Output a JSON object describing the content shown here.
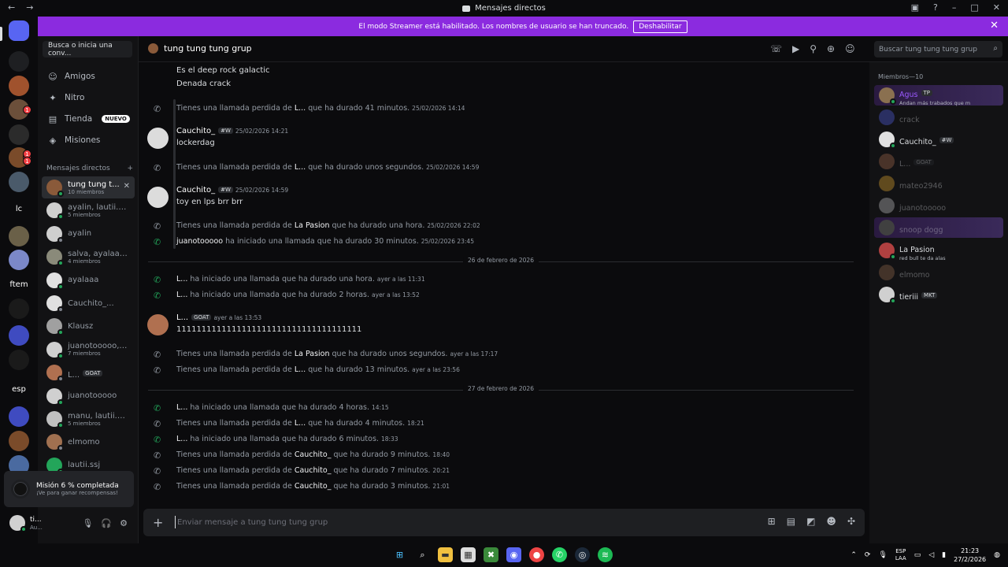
{
  "window": {
    "title": "Mensajes directos",
    "back": "←",
    "forward": "→"
  },
  "banner": {
    "text": "El modo Streamer está habilitado. Los nombres de usuario se han truncado.",
    "button": "Deshabilitar"
  },
  "guilds": [
    {
      "label": "",
      "color": "#5865f2",
      "icon": "discord-icon"
    },
    {
      "label": "",
      "color": "#1e1f22",
      "icon": "z-icon"
    },
    {
      "label": "",
      "color": "#a0522d"
    },
    {
      "label": "",
      "color": "#6b4f3a"
    },
    {
      "label": "",
      "color": "#2b2b2b"
    },
    {
      "label": "",
      "color": "#7a4b2a"
    },
    {
      "label": "",
      "color": "#4a5a6a"
    },
    {
      "label": "lc",
      "color": "transparent"
    },
    {
      "label": "",
      "color": "#6a6048"
    },
    {
      "label": "",
      "color": "#7b88c8"
    },
    {
      "label": "ftem",
      "color": "transparent"
    },
    {
      "label": "",
      "color": "#1a1a1a"
    },
    {
      "label": "",
      "color": "#3f4bc0"
    },
    {
      "label": "",
      "color": "#1a1a1a"
    },
    {
      "label": "esp",
      "color": "transparent"
    },
    {
      "label": "",
      "color": "#3f4bc0"
    },
    {
      "label": "",
      "color": "#7a4b2a"
    },
    {
      "label": "",
      "color": "#4a6aa0"
    }
  ],
  "guild_badges": [
    "1",
    "1",
    "1",
    "1"
  ],
  "sidebar": {
    "search": "Busca o inicia una conv...",
    "nav": [
      {
        "label": "Amigos",
        "icon": "friends-icon"
      },
      {
        "label": "Nitro",
        "icon": "nitro-icon"
      },
      {
        "label": "Tienda",
        "icon": "shop-icon",
        "tag": "NUEVO"
      },
      {
        "label": "Misiones",
        "icon": "quests-icon"
      }
    ],
    "dm_header": "Mensajes directos",
    "dm_add": "+",
    "dms": [
      {
        "name": "tung tung t...",
        "sub": "10 miembros",
        "color": "#8a5a3a",
        "active": true
      },
      {
        "name": "ayalin, lautii.ss...",
        "sub": "5 miembros",
        "color": "#cfcfcf"
      },
      {
        "name": "ayalin",
        "sub": "",
        "color": "#cfcfcf"
      },
      {
        "name": "salva, ayalaaa, ...",
        "sub": "4 miembros",
        "color": "#8a8a7a"
      },
      {
        "name": "ayalaaa",
        "sub": "",
        "color": "#e0e0e0"
      },
      {
        "name": "Cauchito_...",
        "sub": "",
        "color": "#e0e0e0"
      },
      {
        "name": "Klausz",
        "sub": "",
        "color": "#a0a0a0"
      },
      {
        "name": "juanotooooo, ...",
        "sub": "7 miembros",
        "color": "#d0d0d0"
      },
      {
        "name": "L...",
        "sub": "",
        "color": "#b07050",
        "tag": "GOAT"
      },
      {
        "name": "juanotooooo",
        "sub": "",
        "color": "#d0d0d0"
      },
      {
        "name": "manu, lautii.ss...",
        "sub": "5 miembros",
        "color": "#c0c0c0"
      },
      {
        "name": "elmomo",
        "sub": "",
        "color": "#a07050"
      },
      {
        "name": "lautii.ssj",
        "sub": "",
        "color": "#23a55a"
      }
    ],
    "mission": {
      "title": "Misión 6 % completada",
      "sub": "¡Ve para ganar recompensas!"
    },
    "user": {
      "name": "ti...",
      "status": "Au..."
    }
  },
  "chat": {
    "title": "tung tung tung grup",
    "search_placeholder": "Buscar tung tung tung grup",
    "composer_placeholder": "Enviar mensaje a tung tung tung grup",
    "lines": [
      "Es el deep rock galactic",
      "Denada crack"
    ],
    "calls": [
      {
        "pre": "Tienes una llamada perdida de ",
        "who": "L...",
        "post": " que ha durado 41 minutos.",
        "ts": "25/02/2026 14:14",
        "missed": true
      },
      {
        "pre": "Tienes una llamada perdida de ",
        "who": "L...",
        "post": " que ha durado unos segundos.",
        "ts": "25/02/2026 14:59",
        "missed": true
      },
      {
        "pre": "Tienes una llamada perdida de ",
        "who": "La Pasion",
        "post": " que ha durado una hora.",
        "ts": "25/02/2026 22:02",
        "missed": true
      },
      {
        "pre": "",
        "who": "juanotooooo",
        "post": " ha iniciado una llamada que ha durado 30 minutos.",
        "ts": "25/02/2026 23:45",
        "missed": false
      },
      {
        "pre": "",
        "who": "L...",
        "post": " ha iniciado una llamada que ha durado una hora.",
        "ts": "ayer a las 11:31",
        "missed": false
      },
      {
        "pre": "",
        "who": "L...",
        "post": " ha iniciado una llamada que ha durado 2 horas.",
        "ts": "ayer a las 13:52",
        "missed": false
      },
      {
        "pre": "Tienes una llamada perdida de ",
        "who": "La Pasion",
        "post": " que ha durado unos segundos.",
        "ts": "ayer a las 17:17",
        "missed": true
      },
      {
        "pre": "Tienes una llamada perdida de ",
        "who": "L...",
        "post": " que ha durado 13 minutos.",
        "ts": "ayer a las 23:56",
        "missed": true
      },
      {
        "pre": "",
        "who": "L...",
        "post": " ha iniciado una llamada que ha durado 4 horas.",
        "ts": "14:15",
        "missed": false
      },
      {
        "pre": "Tienes una llamada perdida de ",
        "who": "L...",
        "post": " que ha durado 4 minutos.",
        "ts": "18:21",
        "missed": true
      },
      {
        "pre": "",
        "who": "L...",
        "post": " ha iniciado una llamada que ha durado 6 minutos.",
        "ts": "18:33",
        "missed": false
      },
      {
        "pre": "Tienes una llamada perdida de ",
        "who": "Cauchito_",
        "post": " que ha durado 9 minutos.",
        "ts": "18:40",
        "missed": true
      },
      {
        "pre": "Tienes una llamada perdida de ",
        "who": "Cauchito_",
        "post": " que ha durado 7 minutos.",
        "ts": "20:21",
        "missed": true
      },
      {
        "pre": "Tienes una llamada perdida de ",
        "who": "Cauchito_",
        "post": " que ha durado 3 minutos.",
        "ts": "21:01",
        "missed": true
      }
    ],
    "messages": [
      {
        "author": "Cauchito_",
        "tag": "#W",
        "ts": "25/02/2026 14:21",
        "body": "lockerdag"
      },
      {
        "author": "Cauchito_",
        "tag": "#W",
        "ts": "25/02/2026 14:59",
        "body": "toy en lps brr brr"
      },
      {
        "author": "L...",
        "tag": "GOAT",
        "ts": "ayer a las 13:53",
        "body": "1111111111111111111111111111111111111"
      }
    ],
    "dividers": [
      "26 de febrero de 2026",
      "27 de febrero de 2026"
    ]
  },
  "members": {
    "header": "Miembros—10",
    "list": [
      {
        "name": "Agus",
        "tag": "TP",
        "status": "Andan más trabados que m",
        "color": "#8a7050",
        "highlight": true
      },
      {
        "name": "crack",
        "color": "#5865f2",
        "dim": true
      },
      {
        "name": "Cauchito_",
        "tag": "#W",
        "color": "#e0e0e0"
      },
      {
        "name": "L...",
        "tag": "GOAT",
        "color": "#b07050",
        "dim": true
      },
      {
        "name": "mateo2946",
        "color": "#f0b232",
        "dim": true
      },
      {
        "name": "juanotooooo",
        "color": "#d0d0d0",
        "dim": true
      },
      {
        "name": "snoop dogg",
        "color": "#404040",
        "dim": true,
        "highlight": true
      },
      {
        "name": "La Pasion",
        "status": "red bull te da alas",
        "color": "#b04040"
      },
      {
        "name": "elmomo",
        "color": "#a07050",
        "dim": true
      },
      {
        "name": "tieriii",
        "tag": "MKT",
        "color": "#d0d0d0"
      }
    ]
  },
  "taskbar": {
    "lang": "ESP",
    "lang2": "LAA",
    "time": "21:23",
    "date": "27/2/2026"
  }
}
